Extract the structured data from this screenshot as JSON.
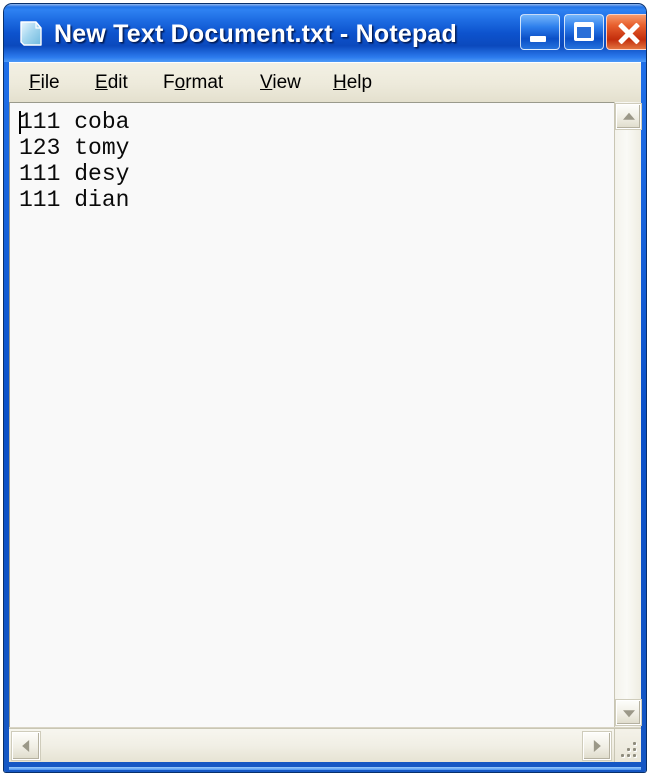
{
  "window": {
    "title": "New Text Document.txt - Notepad",
    "icon": "notepad-document-icon",
    "accent_color": "#0A55CE",
    "titlebar_text_color": "#FFFFFF",
    "menubar_color": "#ECE9D8",
    "client_color": "#F9F9F9"
  },
  "controls": {
    "minimize_label": "Minimize",
    "maximize_label": "Maximize",
    "close_label": "Close"
  },
  "menu": {
    "items": [
      {
        "label": "File",
        "accel": "F",
        "before": "",
        "after": "ile"
      },
      {
        "label": "Edit",
        "accel": "E",
        "before": "",
        "after": "dit"
      },
      {
        "label": "Format",
        "accel": "o",
        "before": "F",
        "after": "rmat"
      },
      {
        "label": "View",
        "accel": "V",
        "before": "",
        "after": "iew"
      },
      {
        "label": "Help",
        "accel": "H",
        "before": "",
        "after": "elp"
      }
    ]
  },
  "document": {
    "lines": [
      "111 coba",
      "123 tomy",
      "111 desy",
      "111 dian"
    ],
    "text": "111 coba\n123 tomy\n111 desy\n111 dian",
    "caret_line": 1,
    "caret_column": 1,
    "font": "monospace",
    "word_wrap": "off"
  },
  "scrollbars": {
    "vertical": {
      "up_arrow": "scroll-up-icon",
      "down_arrow": "scroll-down-icon",
      "thumb_visible": false
    },
    "horizontal": {
      "left_arrow": "scroll-left-icon",
      "right_arrow": "scroll-right-icon",
      "thumb_visible": false
    },
    "resize_grip": "resize-grip-icon"
  }
}
